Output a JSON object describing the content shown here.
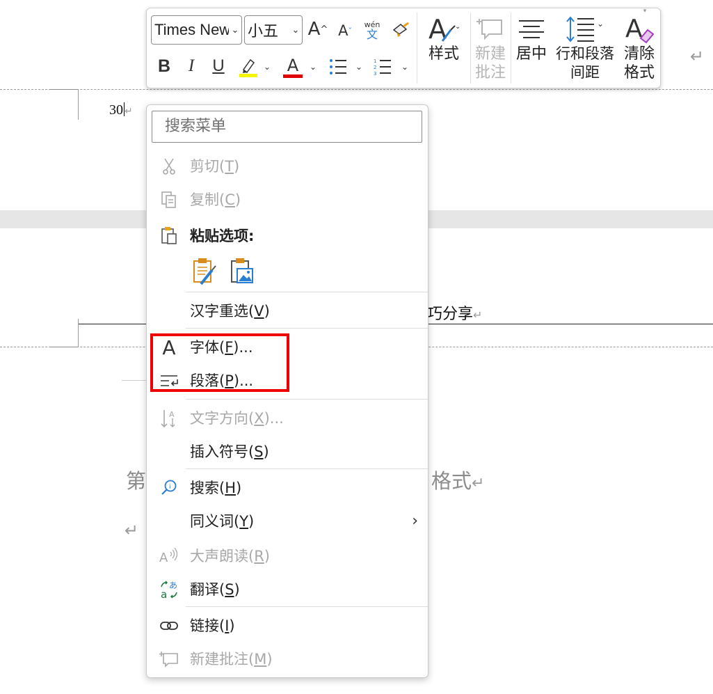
{
  "toolbar": {
    "font_name": "Times New",
    "font_size": "小五",
    "grow_font": "A",
    "shrink_font": "A",
    "phonetic_top": "wén",
    "phonetic_bottom": "文",
    "styles_label": "样式",
    "new_comment_label_1": "新建",
    "new_comment_label_2": "批注",
    "center_label": "居中",
    "line_spacing_label_1": "行和段落",
    "line_spacing_label_2": "间距",
    "clear_format_label_1": "清除",
    "clear_format_label_2": "格式",
    "bold": "B",
    "italic": "I",
    "underline": "U",
    "font_color": "A",
    "highlight_color": "#f5f500",
    "font_color_value": "#e00000"
  },
  "document": {
    "line1_text": "30",
    "line2_fragment": "巧分享",
    "heading_left": "第",
    "heading_right": "格式",
    "para_mark": "↵"
  },
  "menu": {
    "search_placeholder": "搜索菜单",
    "items": [
      {
        "label": "剪切(",
        "acc": "T",
        "tail": ")",
        "icon": "scissors-icon",
        "disabled": true
      },
      {
        "label": "复制(",
        "acc": "C",
        "tail": ")",
        "icon": "copy-icon",
        "disabled": true
      },
      {
        "label": "粘贴选项:",
        "acc": "",
        "tail": "",
        "icon": "paste-icon",
        "disabled": false
      },
      {
        "label": "汉字重选(",
        "acc": "V",
        "tail": ")",
        "icon": "",
        "disabled": false
      },
      {
        "label": "字体(",
        "acc": "F",
        "tail": ")...",
        "icon": "font-icon",
        "disabled": false
      },
      {
        "label": "段落(",
        "acc": "P",
        "tail": ")...",
        "icon": "paragraph-icon",
        "disabled": false
      },
      {
        "label": "文字方向(",
        "acc": "X",
        "tail": ")...",
        "icon": "text-direction-icon",
        "disabled": true
      },
      {
        "label": "插入符号(",
        "acc": "S",
        "tail": ")",
        "icon": "",
        "disabled": false
      },
      {
        "label": "搜索(",
        "acc": "H",
        "tail": ")",
        "icon": "smart-lookup-icon",
        "disabled": false
      },
      {
        "label": "同义词(",
        "acc": "Y",
        "tail": ")",
        "icon": "",
        "disabled": false
      },
      {
        "label": "大声朗读(",
        "acc": "R",
        "tail": ")",
        "icon": "read-aloud-icon",
        "disabled": true
      },
      {
        "label": "翻译(",
        "acc": "S",
        "tail": ")",
        "icon": "translate-icon",
        "disabled": false
      },
      {
        "label": "链接(",
        "acc": "I",
        "tail": ")",
        "icon": "link-icon",
        "disabled": false
      },
      {
        "label": "新建批注(",
        "acc": "M",
        "tail": ")",
        "icon": "new-comment-icon",
        "disabled": true
      }
    ],
    "submenu_arrow": "›",
    "paste_option_1": "keep-source-formatting-icon",
    "paste_option_2": "paste-picture-icon"
  },
  "colors": {
    "highlight_box": "#ee0000",
    "accent_blue": "#2b7cd3",
    "disabled_text": "#a8a8a8"
  }
}
